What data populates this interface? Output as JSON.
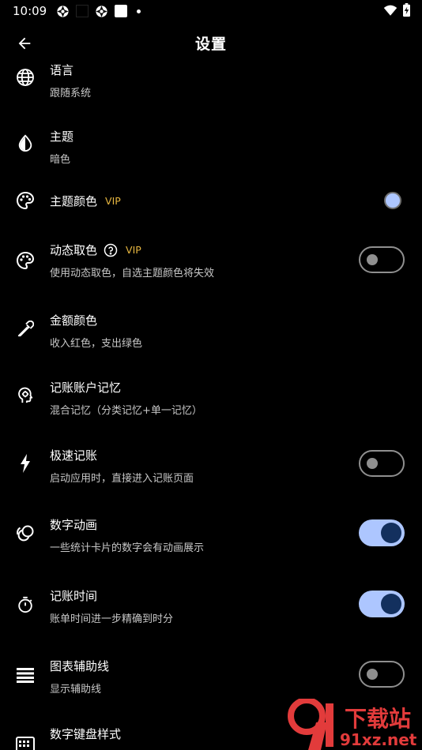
{
  "status_bar": {
    "time": "10:09"
  },
  "app_bar": {
    "title": "设置"
  },
  "settings": [
    {
      "id": "language",
      "title": "语言",
      "subtitle": "跟随系统",
      "icon": "globe-icon",
      "control": "none"
    },
    {
      "id": "theme",
      "title": "主题",
      "subtitle": "暗色",
      "icon": "water-drop-icon",
      "control": "none"
    },
    {
      "id": "theme-color",
      "title": "主题颜色",
      "vip": "VIP",
      "subtitle": "",
      "icon": "palette-icon",
      "control": "color",
      "color": "#adc6ff"
    },
    {
      "id": "dynamic-color",
      "title": "动态取色",
      "vip": "VIP",
      "subtitle": "使用动态取色，自选主题颜色将失效",
      "icon": "palette-icon",
      "control": "toggle",
      "on": false
    },
    {
      "id": "amount-color",
      "title": "金额颜色",
      "subtitle": "收入红色，支出绿色",
      "icon": "eyedropper-icon",
      "control": "none"
    },
    {
      "id": "account-memory",
      "title": "记账账户记忆",
      "subtitle": "混合记忆（分类记忆+单一记忆）",
      "icon": "brain-head-icon",
      "control": "none"
    },
    {
      "id": "quick-entry",
      "title": "极速记账",
      "subtitle": "启动应用时，直接进入记账页面",
      "icon": "lightning-icon",
      "control": "toggle",
      "on": false
    },
    {
      "id": "number-animation",
      "title": "数字动画",
      "subtitle": "一些统计卡片的数字会有动画展示",
      "icon": "animation-icon",
      "control": "toggle",
      "on": true
    },
    {
      "id": "entry-time",
      "title": "记账时间",
      "subtitle": "账单时间进一步精确到时分",
      "icon": "timer-icon",
      "control": "toggle",
      "on": true
    },
    {
      "id": "chart-gridlines",
      "title": "图表辅助线",
      "subtitle": "显示辅助线",
      "icon": "gridlines-icon",
      "control": "toggle",
      "on": false
    },
    {
      "id": "keypad-style",
      "title": "数字键盘样式",
      "subtitle": "",
      "icon": "keyboard-icon",
      "control": "none"
    }
  ],
  "watermark": {
    "brand": "91",
    "cn": "下载站",
    "domain": "91xz.net"
  },
  "colors": {
    "accent": "#adc6ff",
    "knob_on": "#13305e",
    "vip": "#e6b640",
    "toggle_off": "#8f8f8f"
  }
}
